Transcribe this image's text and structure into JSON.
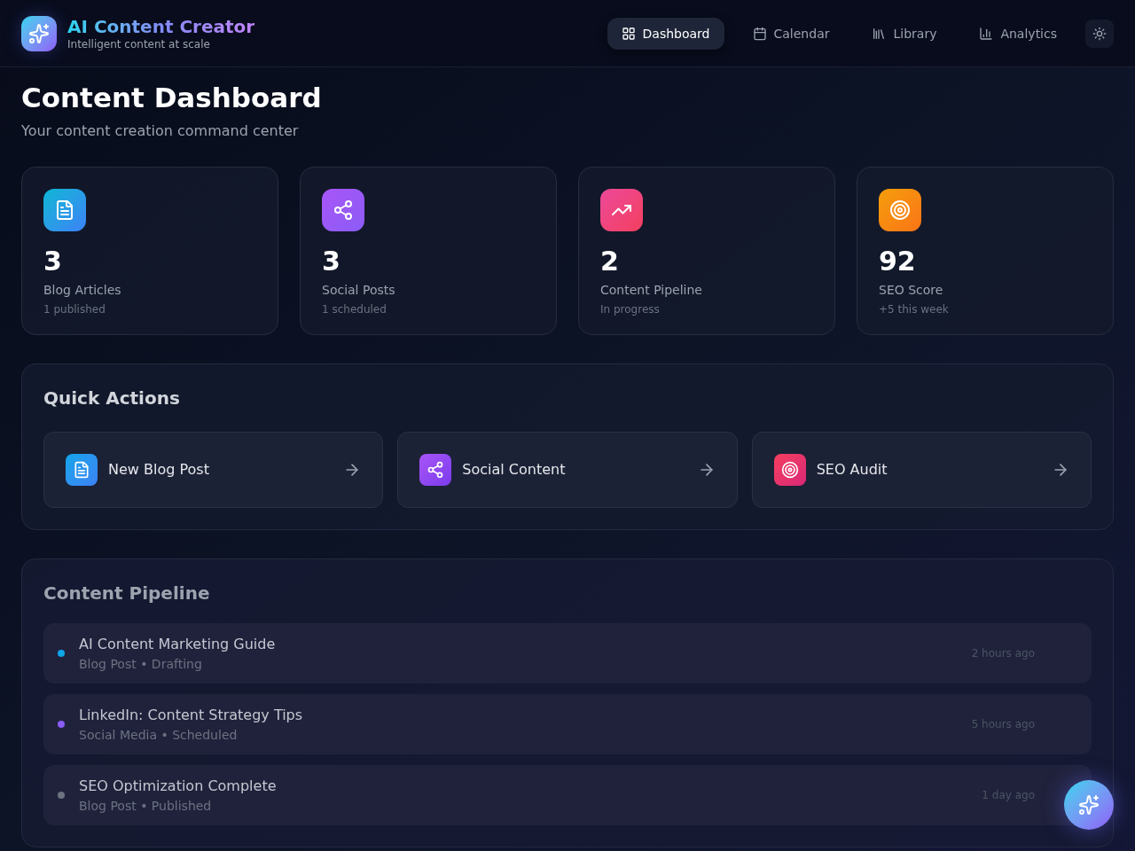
{
  "header": {
    "title": "AI Content Creator",
    "subtitle": "Intelligent content at scale"
  },
  "nav": [
    {
      "label": "Dashboard",
      "kind": "grid",
      "selected": true
    },
    {
      "label": "Calendar",
      "kind": "calendar",
      "selected": false
    },
    {
      "label": "Library",
      "kind": "library",
      "selected": false
    },
    {
      "label": "Analytics",
      "kind": "chart",
      "selected": false
    }
  ],
  "page": {
    "title": "Content Dashboard",
    "subtitle": "Your content creation command center"
  },
  "stats": [
    {
      "kind": "blog",
      "value": "3",
      "label": "Blog Articles",
      "note": "1 published"
    },
    {
      "kind": "social",
      "value": "3",
      "label": "Social Posts",
      "note": "1 scheduled"
    },
    {
      "kind": "pipeline",
      "value": "2",
      "label": "Content Pipeline",
      "note": "In progress"
    },
    {
      "kind": "seo",
      "value": "92",
      "label": "SEO Score",
      "note": "+5 this week"
    }
  ],
  "quick_actions": {
    "title": "Quick Actions",
    "items": [
      {
        "kind": "blog",
        "label": "New Blog Post"
      },
      {
        "kind": "social",
        "label": "Social Content"
      },
      {
        "kind": "seo",
        "label": "SEO Audit"
      }
    ]
  },
  "pipeline": {
    "title": "Content Pipeline",
    "items": [
      {
        "title": "AI Content Marketing Guide",
        "meta": "Blog Post • Drafting",
        "time": "2 hours ago",
        "color": "#0ea5e9"
      },
      {
        "title": "LinkedIn: Content Strategy Tips",
        "meta": "Social Media • Scheduled",
        "time": "5 hours ago",
        "color": "#8b5cf6"
      },
      {
        "title": "SEO Optimization Complete",
        "meta": "Blog Post • Published",
        "time": "1 day ago",
        "color": "#6b7280"
      }
    ]
  }
}
